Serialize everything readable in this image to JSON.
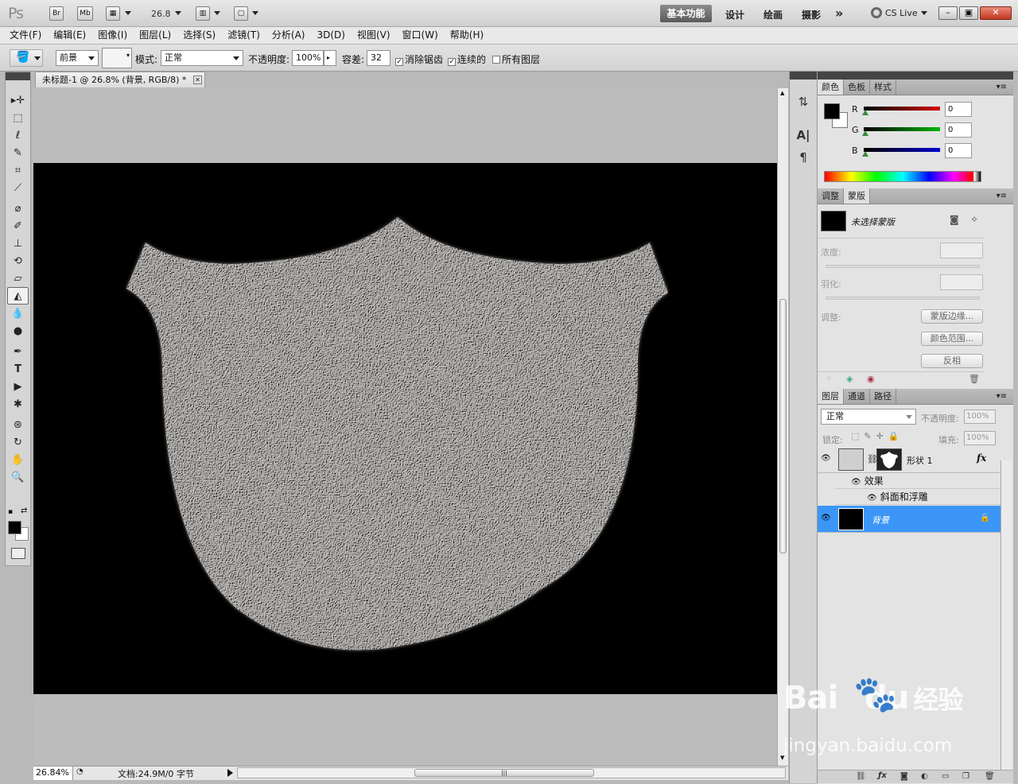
{
  "app": {
    "logo": "Ps",
    "bridge_btn": "Br",
    "minibridge_btn": "Mb",
    "zoom_level": "26.8",
    "workspaces": [
      "基本功能",
      "设计",
      "绘画",
      "摄影"
    ],
    "more": "»",
    "cs_live": "CS Live",
    "min": "–",
    "restore": "▣",
    "close": "✕"
  },
  "menu": [
    "文件(F)",
    "编辑(E)",
    "图像(I)",
    "图层(L)",
    "选择(S)",
    "滤镜(T)",
    "分析(A)",
    "3D(D)",
    "视图(V)",
    "窗口(W)",
    "帮助(H)"
  ],
  "options": {
    "fill_source": "前景",
    "mode_label": "模式:",
    "mode_value": "正常",
    "opacity_label": "不透明度:",
    "opacity_value": "100%",
    "tolerance_label": "容差:",
    "tolerance_value": "32",
    "antialias_label": "消除锯齿",
    "contiguous_label": "连续的",
    "all_layers_label": "所有图层"
  },
  "document": {
    "tab_title": "未标题-1 @ 26.8% (背景, RGB/8) *",
    "status_zoom": "26.84%",
    "status_doc": "文档:24.9M/0 字节"
  },
  "color_panel": {
    "tabs": [
      "颜色",
      "色板",
      "样式"
    ],
    "channels": [
      {
        "label": "R",
        "value": "0",
        "color": "#d80000"
      },
      {
        "label": "G",
        "value": "0",
        "color": "#00b400"
      },
      {
        "label": "B",
        "value": "0",
        "color": "#0000d0"
      }
    ]
  },
  "mask_panel": {
    "tabs": [
      "调整",
      "蒙版"
    ],
    "title": "未选择蒙版",
    "density_label": "浓度:",
    "feather_label": "羽化:",
    "refine_label": "调整:",
    "btn_edge": "蒙版边缘...",
    "btn_range": "颜色范围...",
    "btn_invert": "反相"
  },
  "layers_panel": {
    "tabs": [
      "图层",
      "通道",
      "路径"
    ],
    "blend_mode": "正常",
    "opacity_label": "不透明度:",
    "opacity_value": "100%",
    "lock_label": "锁定:",
    "fill_label": "填充:",
    "fill_value": "100%",
    "layers": [
      {
        "name": "形状 1",
        "fx": "fx",
        "effects_label": "效果",
        "effect": "斜面和浮雕"
      },
      {
        "name": "背景",
        "locked": true
      }
    ]
  },
  "watermark": {
    "brand": "Bai",
    "brand2": "du",
    "brand3": "经验",
    "url": "jingyan.baidu.com"
  }
}
